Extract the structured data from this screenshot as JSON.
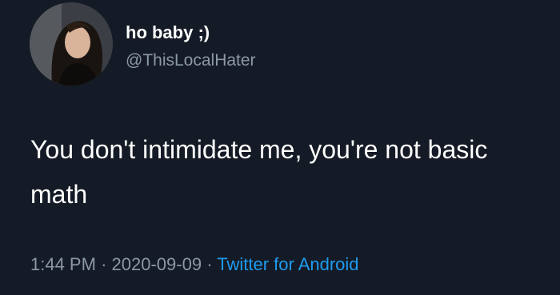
{
  "user": {
    "display_name": "ho baby ;)",
    "handle": "@ThisLocalHater",
    "avatar_icon": "profile-photo"
  },
  "tweet": {
    "text": "You don't intimidate me, you're not basic math",
    "time": "1:44 PM",
    "separator": "·",
    "date": "2020-09-09",
    "source": "Twitter for Android"
  },
  "colors": {
    "background": "#151b26",
    "text": "#ffffff",
    "muted": "#8b98a5",
    "link": "#1d9bf0"
  }
}
